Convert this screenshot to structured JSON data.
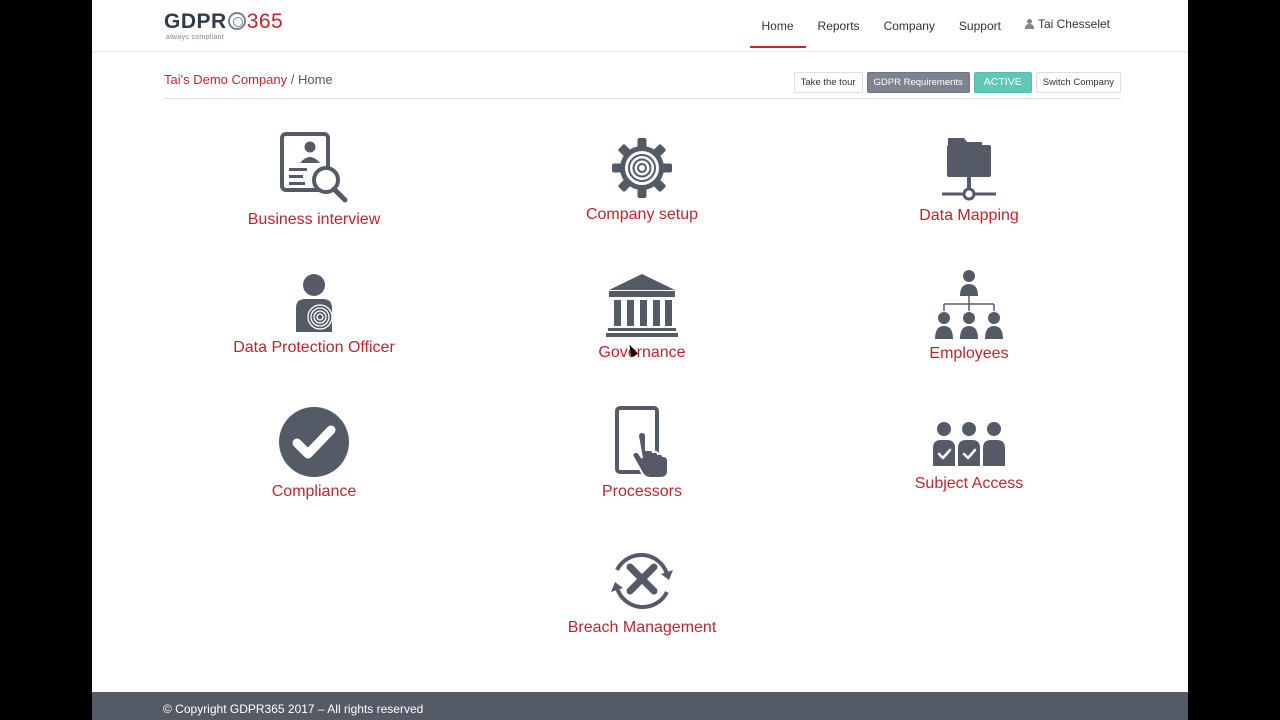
{
  "header": {
    "logo": {
      "main": "GDPR",
      "num": "365",
      "tagline": "always compliant"
    },
    "nav": [
      {
        "label": "Home",
        "active": true
      },
      {
        "label": "Reports"
      },
      {
        "label": "Company"
      },
      {
        "label": "Support"
      }
    ],
    "user": "Tai Chesselet"
  },
  "breadcrumb": {
    "company": "Tai's Demo Company",
    "separator": " / ",
    "current": "Home"
  },
  "actions": {
    "tour": "Take the tour",
    "requirements": "GDPR Requirements",
    "status": "ACTIVE",
    "switch": "Switch Company"
  },
  "tiles": [
    {
      "label": "Business interview",
      "icon": "document-search-icon"
    },
    {
      "label": "Company setup",
      "icon": "gear-icon"
    },
    {
      "label": "Data Mapping",
      "icon": "folder-network-icon"
    },
    {
      "label": "Data Protection Officer",
      "icon": "fingerprint-person-icon"
    },
    {
      "label": "Governance",
      "icon": "bank-icon"
    },
    {
      "label": "Employees",
      "icon": "org-chart-icon"
    },
    {
      "label": "Compliance",
      "icon": "checkmark-circle-icon"
    },
    {
      "label": "Processors",
      "icon": "tablet-touch-icon"
    },
    {
      "label": "Subject Access",
      "icon": "group-check-icon"
    },
    {
      "label": "Breach Management",
      "icon": "breach-x-icon"
    }
  ],
  "footer": {
    "copyright": "© Copyright GDPR365 2017 – All rights reserved"
  },
  "colors": {
    "accent": "#c0242f",
    "icon": "#555b66",
    "active": "#5fc7b4",
    "footer": "#555b66"
  }
}
